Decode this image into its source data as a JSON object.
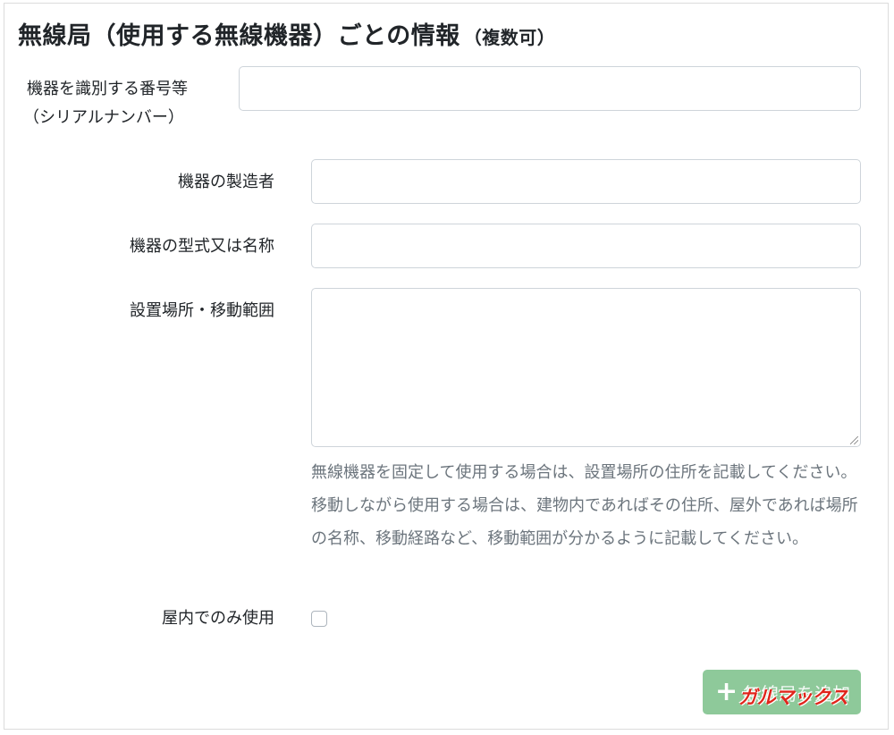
{
  "section": {
    "title": "無線局（使用する無線機器）ごとの情報",
    "title_note": "（複数可）"
  },
  "fields": {
    "serial_label_line1": "機器を識別する番号等",
    "serial_label_line2": "（シリアルナンバー）",
    "serial_value": "",
    "manufacturer_label": "機器の製造者",
    "manufacturer_value": "",
    "model_label": "機器の型式又は名称",
    "model_value": "",
    "location_label": "設置場所・移動範囲",
    "location_value": "",
    "location_help": "無線機器を固定して使用する場合は、設置場所の住所を記載してください。移動しながら使用する場合は、建物内であればその住所、屋外であれば場所の名称、移動経路など、移動範囲が分かるように記載してください。",
    "indoor_label": "屋内でのみ使用",
    "indoor_checked": false
  },
  "actions": {
    "add_button_label": "無線局を追加",
    "add_icon": "plus-icon"
  },
  "watermark": {
    "text": "ガルマックス"
  },
  "colors": {
    "add_button_bg": "#8ec99a",
    "help_text": "#6c757d",
    "input_border": "#ced4da",
    "watermark": "#e0251b"
  }
}
